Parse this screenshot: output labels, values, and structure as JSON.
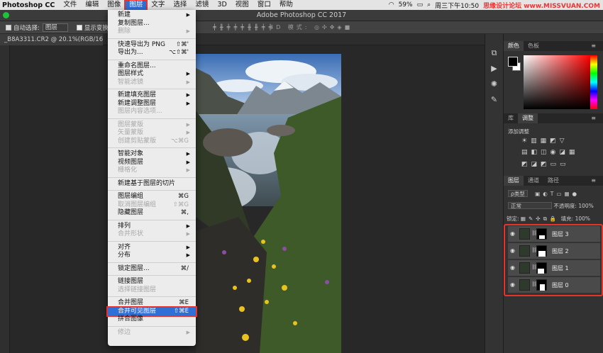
{
  "menubar": {
    "app": "Photoshop CC",
    "items": [
      "文件",
      "编辑",
      "图像",
      "图层",
      "文字",
      "选择",
      "滤镜",
      "3D",
      "视图",
      "窗口",
      "帮助"
    ],
    "active_index": 3,
    "right": {
      "battery": "59%",
      "time": "周三下午10:50",
      "watermark": "思缘设计论坛 www.MISSVUAN.COM"
    }
  },
  "titlebar": {
    "title": "Adobe Photoshop CC 2017"
  },
  "options": {
    "auto_select_label": "自动选择:",
    "auto_select_target": "图层",
    "transform_label": "显示变换控件",
    "mode3d": "3D 模式:"
  },
  "document_tab": {
    "label": "_B8A3311.CR2 @ 20.1%(RGB/16*) *"
  },
  "layer_menu": {
    "items": [
      {
        "label": "新建",
        "shortcut": "",
        "arrow": "▶",
        "disabled": false
      },
      {
        "label": "复制图层...",
        "shortcut": "",
        "arrow": "",
        "disabled": false
      },
      {
        "label": "删除",
        "shortcut": "",
        "arrow": "▶",
        "disabled": true
      },
      {
        "sep": true
      },
      {
        "label": "快速导出为 PNG",
        "shortcut": "⇧⌘'",
        "arrow": "",
        "disabled": false
      },
      {
        "label": "导出为...",
        "shortcut": "⌥⇧⌘'",
        "arrow": "",
        "disabled": false
      },
      {
        "sep": true
      },
      {
        "label": "重命名图层...",
        "shortcut": "",
        "arrow": "",
        "disabled": false
      },
      {
        "label": "图层样式",
        "shortcut": "",
        "arrow": "▶",
        "disabled": false
      },
      {
        "label": "智能滤镜",
        "shortcut": "",
        "arrow": "▶",
        "disabled": true
      },
      {
        "sep": true
      },
      {
        "label": "新建填充图层",
        "shortcut": "",
        "arrow": "▶",
        "disabled": false
      },
      {
        "label": "新建调整图层",
        "shortcut": "",
        "arrow": "▶",
        "disabled": false
      },
      {
        "label": "图层内容选项...",
        "shortcut": "",
        "arrow": "",
        "disabled": true
      },
      {
        "sep": true
      },
      {
        "label": "图层蒙版",
        "shortcut": "",
        "arrow": "▶",
        "disabled": true
      },
      {
        "label": "矢量蒙版",
        "shortcut": "",
        "arrow": "▶",
        "disabled": true
      },
      {
        "label": "创建剪贴蒙版",
        "shortcut": "⌥⌘G",
        "arrow": "",
        "disabled": true
      },
      {
        "sep": true
      },
      {
        "label": "智能对象",
        "shortcut": "",
        "arrow": "▶",
        "disabled": false
      },
      {
        "label": "视频图层",
        "shortcut": "",
        "arrow": "▶",
        "disabled": false
      },
      {
        "label": "栅格化",
        "shortcut": "",
        "arrow": "▶",
        "disabled": true
      },
      {
        "sep": true
      },
      {
        "label": "新建基于图层的切片",
        "shortcut": "",
        "arrow": "",
        "disabled": false
      },
      {
        "sep": true
      },
      {
        "label": "图层编组",
        "shortcut": "⌘G",
        "arrow": "",
        "disabled": false
      },
      {
        "label": "取消图层编组",
        "shortcut": "⇧⌘G",
        "arrow": "",
        "disabled": true
      },
      {
        "label": "隐藏图层",
        "shortcut": "⌘,",
        "arrow": "",
        "disabled": false
      },
      {
        "sep": true
      },
      {
        "label": "排列",
        "shortcut": "",
        "arrow": "▶",
        "disabled": false
      },
      {
        "label": "合并形状",
        "shortcut": "",
        "arrow": "▶",
        "disabled": true
      },
      {
        "sep": true
      },
      {
        "label": "对齐",
        "shortcut": "",
        "arrow": "▶",
        "disabled": false
      },
      {
        "label": "分布",
        "shortcut": "",
        "arrow": "▶",
        "disabled": false
      },
      {
        "sep": true
      },
      {
        "label": "锁定图层...",
        "shortcut": "⌘/",
        "arrow": "",
        "disabled": false
      },
      {
        "sep": true
      },
      {
        "label": "链接图层",
        "shortcut": "",
        "arrow": "",
        "disabled": false
      },
      {
        "label": "选择链接图层",
        "shortcut": "",
        "arrow": "",
        "disabled": true
      },
      {
        "sep": true
      },
      {
        "label": "合并图层",
        "shortcut": "⌘E",
        "arrow": "",
        "disabled": false
      },
      {
        "label": "合并可见图层",
        "shortcut": "⇧⌘E",
        "arrow": "",
        "disabled": false,
        "highlighted": true
      },
      {
        "label": "拼合图像",
        "shortcut": "",
        "arrow": "",
        "disabled": false
      },
      {
        "sep": true
      },
      {
        "label": "修边",
        "shortcut": "",
        "arrow": "▶",
        "disabled": true
      }
    ]
  },
  "color_panel": {
    "tabs": [
      "颜色",
      "色板"
    ],
    "foreground": "#000000",
    "background": "#ffffff"
  },
  "adjust_panel": {
    "tabs": [
      "库",
      "调整"
    ],
    "title": "添加调整"
  },
  "layers_panel": {
    "tabs": [
      "图层",
      "通道",
      "路径"
    ],
    "filter_label": "ρ类型",
    "blend_mode": "正常",
    "opacity_label": "不透明度:",
    "opacity_value": "100%",
    "lock_label": "锁定:",
    "fill_label": "填充:",
    "fill_value": "100%",
    "layers": [
      {
        "name": "图层 3"
      },
      {
        "name": "图层 2"
      },
      {
        "name": "图层 1"
      },
      {
        "name": "图层 0"
      }
    ]
  },
  "colors": {
    "accent": "#2f6fd6",
    "highlight_border": "#e8322a"
  }
}
